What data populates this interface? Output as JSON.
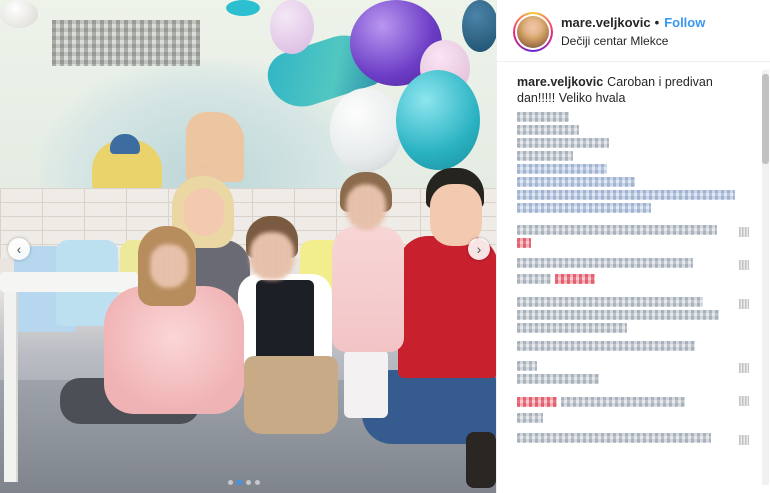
{
  "post": {
    "username": "mare.veljkovic",
    "separator": "•",
    "follow_label": "Follow",
    "location": "Dečiji centar Mlekce",
    "caption_user": "mare.veljkovic",
    "caption_text": "Caroban i predivan dan!!!!! Veliko hvala"
  },
  "carousel": {
    "slide_count": 4,
    "active_slide": 2,
    "prev_icon": "‹",
    "next_icon": "›"
  },
  "colors": {
    "accent_blue": "#3897f0",
    "text": "#262626",
    "border": "#efefef"
  },
  "icons": {
    "avatar": "profile-avatar",
    "prev": "chevron-left-icon",
    "next": "chevron-right-icon",
    "like": "heart-icon"
  }
}
